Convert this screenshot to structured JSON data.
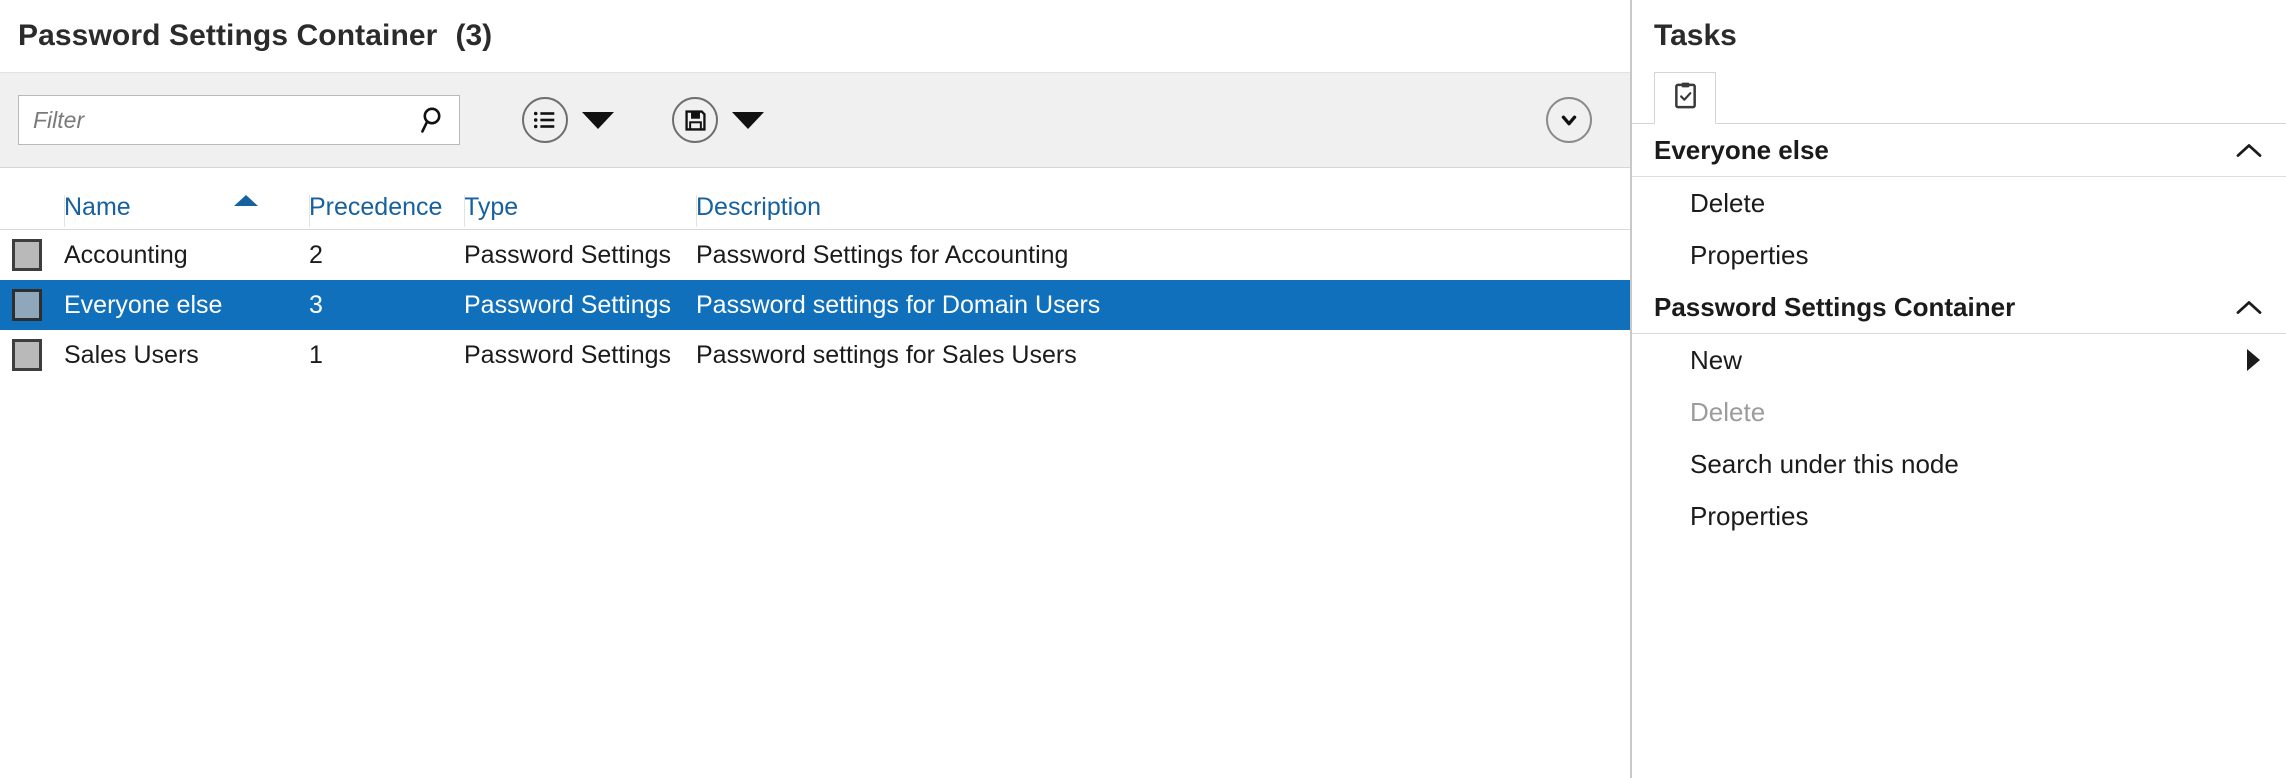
{
  "list_pane": {
    "title": "Password Settings Container",
    "count": "(3)",
    "toolbar": {
      "filter_placeholder": "Filter",
      "filter_value": "",
      "search_icon": "search-icon",
      "view_icon": "list-view-icon",
      "view_caret": "caret-down-icon",
      "save_icon": "save-floppy-icon",
      "save_caret": "caret-down-icon",
      "expander_icon": "chevron-down-circle-icon"
    },
    "columns": [
      {
        "key": "icon",
        "label": "",
        "sort": ""
      },
      {
        "key": "name",
        "label": "Name",
        "sort": "asc"
      },
      {
        "key": "precedence",
        "label": "Precedence",
        "sort": ""
      },
      {
        "key": "type",
        "label": "Type",
        "sort": ""
      },
      {
        "key": "description",
        "label": "Description",
        "sort": ""
      }
    ],
    "rows": [
      {
        "icon": "object-icon",
        "name": "Accounting",
        "precedence": "2",
        "type": "Password Settings",
        "description": "Password Settings for Accounting",
        "selected": false
      },
      {
        "icon": "object-icon",
        "name": "Everyone else",
        "precedence": "3",
        "type": "Password Settings",
        "description": "Password settings for Domain Users",
        "selected": true
      },
      {
        "icon": "object-icon",
        "name": "Sales Users",
        "precedence": "1",
        "type": "Password Settings",
        "description": "Password settings for Sales Users",
        "selected": false
      }
    ]
  },
  "tasks_pane": {
    "title": "Tasks",
    "tab_icon": "clipboard-check-icon",
    "sections": [
      {
        "title": "Everyone else",
        "collapse_icon": "chevron-up-icon",
        "accented": false,
        "items": [
          {
            "label": "Delete",
            "disabled": false,
            "submenu": false
          },
          {
            "label": "Properties",
            "disabled": false,
            "submenu": false
          }
        ]
      },
      {
        "title": "Password Settings Container",
        "collapse_icon": "chevron-up-icon",
        "accented": true,
        "items": [
          {
            "label": "New",
            "disabled": false,
            "submenu": true
          },
          {
            "label": "Delete",
            "disabled": true,
            "submenu": false
          },
          {
            "label": "Search under this node",
            "disabled": false,
            "submenu": false
          },
          {
            "label": "Properties",
            "disabled": false,
            "submenu": false
          }
        ]
      }
    ]
  },
  "colors": {
    "selection_blue": "#1070bc",
    "header_link_blue": "#17619e",
    "toolbar_bg": "#f0f0f0",
    "disabled_text": "#9c9c9c"
  }
}
